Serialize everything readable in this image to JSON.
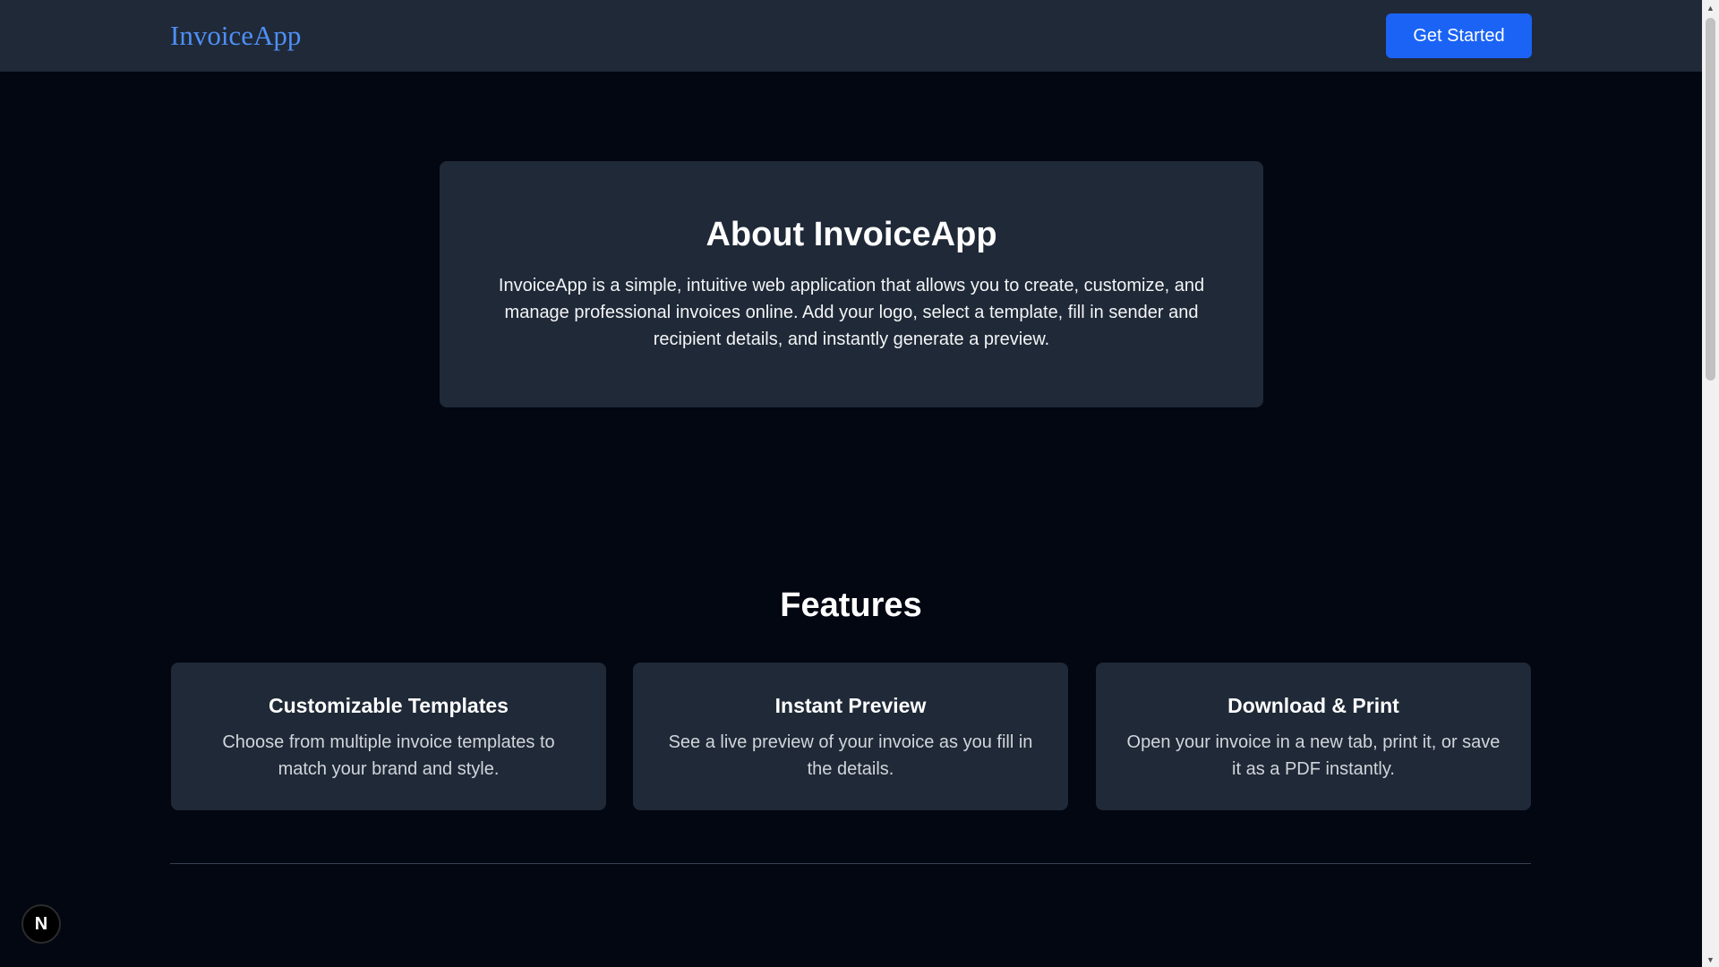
{
  "header": {
    "brand": "InvoiceApp",
    "cta_label": "Get Started"
  },
  "about": {
    "title": "About InvoiceApp",
    "body": "InvoiceApp is a simple, intuitive web application that allows you to create, customize, and manage professional invoices online. Add your logo, select a template, fill in sender and recipient details, and instantly generate a preview."
  },
  "features": {
    "title": "Features",
    "items": [
      {
        "title": "Customizable Templates",
        "description": "Choose from multiple invoice templates to match your brand and style."
      },
      {
        "title": "Instant Preview",
        "description": "See a live preview of your invoice as you fill in the details."
      },
      {
        "title": "Download & Print",
        "description": "Open your invoice in a new tab, print it, or save it as a PDF instantly."
      }
    ]
  },
  "dev_badge": {
    "letter": "N",
    "icon": "nextjs-logo-icon"
  },
  "colors": {
    "background": "#030712",
    "surface": "#1f2937",
    "brand": "#4f8ff7",
    "primary_button": "#1a63f5"
  }
}
